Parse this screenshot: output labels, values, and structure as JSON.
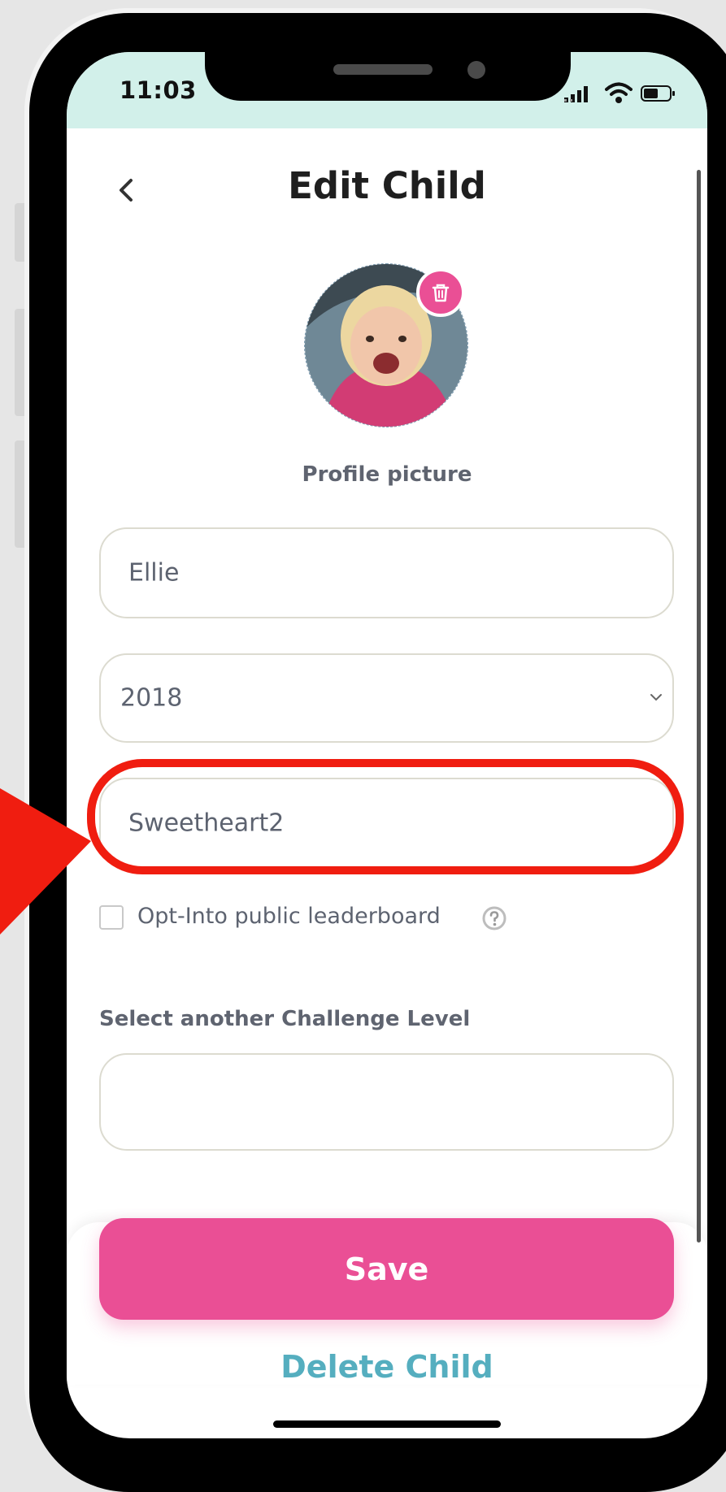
{
  "status_bar": {
    "time": "11:03"
  },
  "header": {
    "title": "Edit Child"
  },
  "profile": {
    "picture_label": "Profile picture"
  },
  "form": {
    "name_value": "Ellie",
    "birth_year_value": "2018",
    "nickname_value": "Sweetheart2",
    "leaderboard_label": "Opt-Into public leaderboard",
    "leaderboard_checked": false,
    "challenge_label": "Select another Challenge Level",
    "challenge_value": ""
  },
  "actions": {
    "save_label": "Save",
    "delete_label": "Delete Child"
  },
  "colors": {
    "status_bar": "#d2f0ea",
    "primary_pink": "#ea4f95",
    "delete_teal": "#55aebf",
    "highlight_red": "#f01d10"
  },
  "icons": [
    "back-chevron-icon",
    "trash-icon",
    "chevron-down-icon",
    "help-icon",
    "signal-icon",
    "wifi-icon",
    "battery-icon"
  ]
}
